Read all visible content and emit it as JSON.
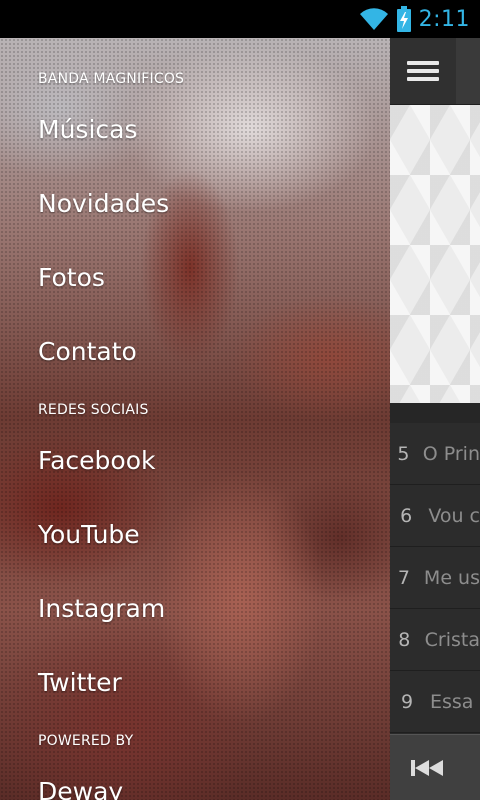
{
  "status_bar": {
    "time": "2:11",
    "wifi_icon": "wifi-icon",
    "battery_icon": "battery-charging-icon"
  },
  "drawer": {
    "section_band": "BANDA MAGNIFICOS",
    "band_items": [
      {
        "label": "Músicas"
      },
      {
        "label": "Novidades"
      },
      {
        "label": "Fotos"
      },
      {
        "label": "Contato"
      }
    ],
    "section_social": "REDES SOCIAIS",
    "social_items": [
      {
        "label": "Facebook"
      },
      {
        "label": "YouTube"
      },
      {
        "label": "Instagram"
      },
      {
        "label": "Twitter"
      }
    ],
    "section_powered": "POWERED BY",
    "powered_item": {
      "label": "Deway"
    }
  },
  "app": {
    "menu_icon": "hamburger-menu-icon",
    "tracks": [
      {
        "num": "5",
        "title": "O Prin"
      },
      {
        "num": "6",
        "title": "Vou c"
      },
      {
        "num": "7",
        "title": "Me us"
      },
      {
        "num": "8",
        "title": "Crista"
      },
      {
        "num": "9",
        "title": "Essa"
      }
    ],
    "player_icon": "previous-track-icon"
  },
  "colors": {
    "status_accent": "#33b5e5",
    "drawer_text": "#ffffff"
  }
}
